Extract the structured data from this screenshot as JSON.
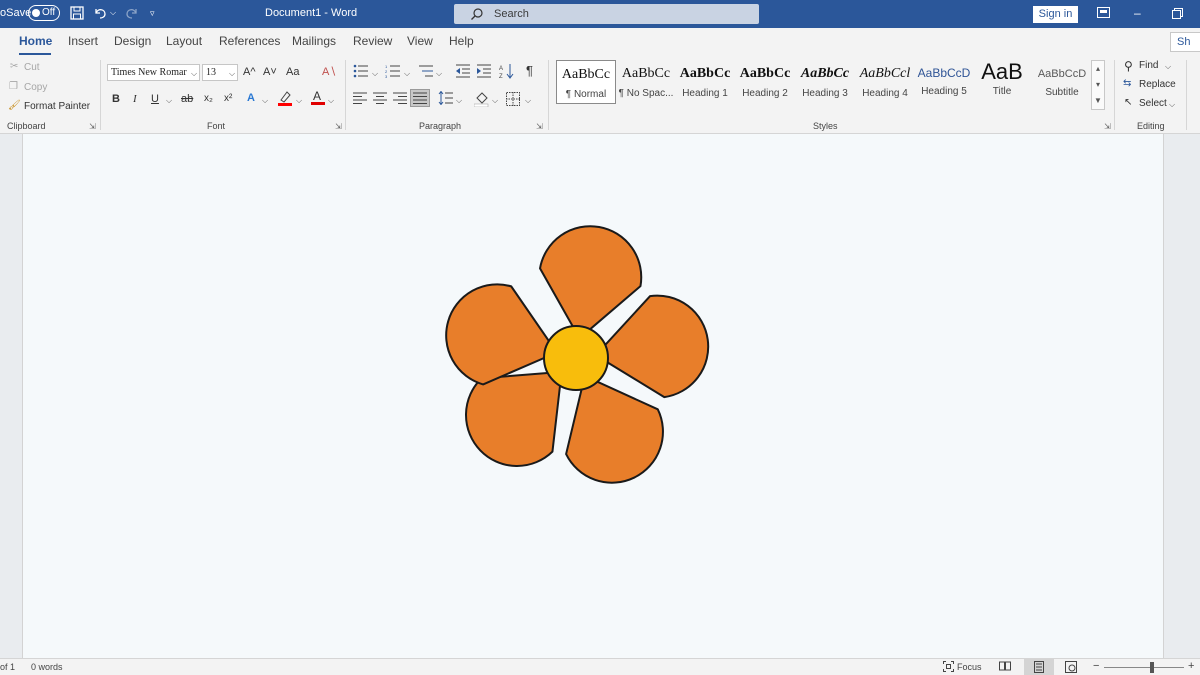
{
  "titlebar": {
    "autosave_label": "oSave",
    "toggle_label": "Off",
    "doc_title": "Document1  -  Word",
    "search_placeholder": "Search",
    "signin_label": "Sign in"
  },
  "tabs": [
    "Home",
    "Insert",
    "Design",
    "Layout",
    "References",
    "Mailings",
    "Review",
    "View",
    "Help"
  ],
  "share_label": "Sh",
  "clipboard": {
    "cut": "Cut",
    "copy": "Copy",
    "format_painter": "Format Painter",
    "group_label": "Clipboard"
  },
  "font": {
    "family": "Times New Romar",
    "size": "13",
    "group_label": "Font",
    "bold": "B",
    "italic": "I",
    "underline": "U",
    "strike": "ab",
    "sub": "x₂",
    "sup": "x²",
    "case": "Aa",
    "grow": "A^",
    "shrink": "A˅"
  },
  "paragraph": {
    "group_label": "Paragraph",
    "pilcrow": "¶"
  },
  "styles": {
    "group_label": "Styles",
    "items": [
      {
        "sample": "AaBbCc",
        "name": "¶ Normal"
      },
      {
        "sample": "AaBbCc",
        "name": "¶ No Spac..."
      },
      {
        "sample": "AaBbCc",
        "name": "Heading 1"
      },
      {
        "sample": "AaBbCc",
        "name": "Heading 2"
      },
      {
        "sample": "AaBbCc",
        "name": "Heading 3"
      },
      {
        "sample": "AaBbCcl",
        "name": "Heading 4"
      },
      {
        "sample": "AaBbCcD",
        "name": "Heading 5"
      },
      {
        "sample": "AaB",
        "name": "Title"
      },
      {
        "sample": "AaBbCcD",
        "name": "Subtitle"
      }
    ]
  },
  "editing": {
    "find": "Find",
    "replace": "Replace",
    "select": "Select",
    "group_label": "Editing"
  },
  "statusbar": {
    "page": "of 1",
    "words": "0 words",
    "focus": "Focus",
    "zoom_minus": "−",
    "zoom_plus": "+"
  },
  "colors": {
    "brand": "#2b579a",
    "petal": "#e87e2a",
    "center": "#f8bd0c",
    "outline": "#1a1a1a"
  },
  "icons": [
    "save-icon",
    "undo-icon",
    "redo-icon",
    "customize-icon",
    "search-icon",
    "ribbon-display-icon",
    "minimize-icon",
    "restore-icon",
    "cut-icon",
    "copy-icon",
    "format-painter-icon",
    "clear-format-icon",
    "bullets-icon",
    "numbering-icon",
    "multilevel-icon",
    "decrease-indent-icon",
    "increase-indent-icon",
    "sort-icon",
    "pilcrow-icon",
    "find-icon",
    "replace-icon",
    "select-icon"
  ]
}
